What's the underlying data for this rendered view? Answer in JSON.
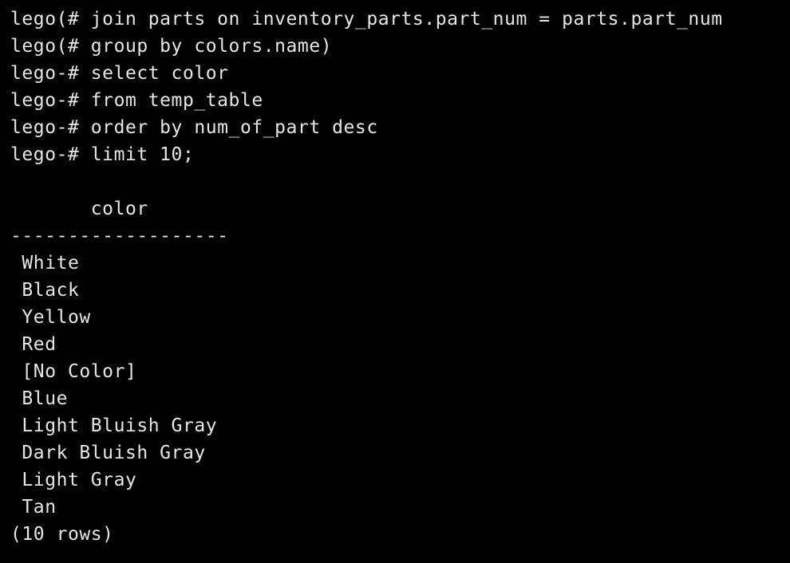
{
  "prompt_lines": [
    {
      "prompt": "lego(# ",
      "command": "join parts on inventory_parts.part_num = parts.part_num"
    },
    {
      "prompt": "lego(# ",
      "command": "group by colors.name)"
    },
    {
      "prompt": "lego-# ",
      "command": "select color"
    },
    {
      "prompt": "lego-# ",
      "command": "from temp_table"
    },
    {
      "prompt": "lego-# ",
      "command": "order by num_of_part desc"
    },
    {
      "prompt": "lego-# ",
      "command": "limit 10;"
    }
  ],
  "result": {
    "header": "       color",
    "separator": "-------------------",
    "rows": [
      " White",
      " Black",
      " Yellow",
      " Red",
      " [No Color]",
      " Blue",
      " Light Bluish Gray",
      " Dark Bluish Gray",
      " Light Gray",
      " Tan"
    ],
    "footer": "(10 rows)"
  }
}
